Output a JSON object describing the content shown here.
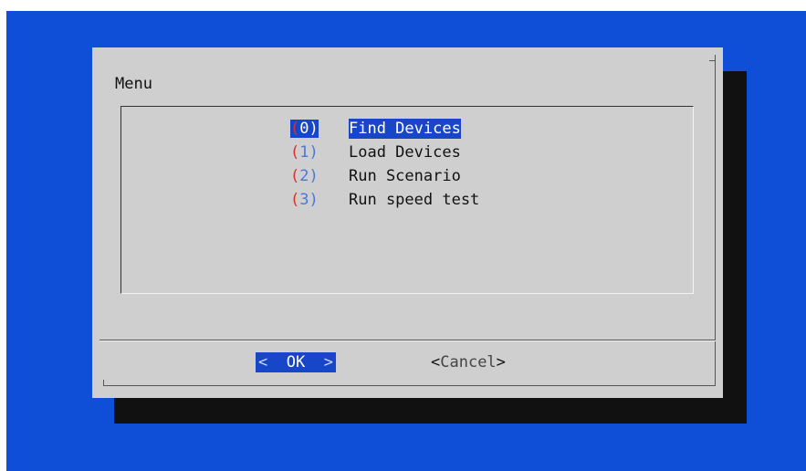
{
  "dialog": {
    "title": "Menu"
  },
  "menu": {
    "items": [
      {
        "tag": "0",
        "label": "Find Devices",
        "selected": true
      },
      {
        "tag": "1",
        "label": "Load Devices",
        "selected": false
      },
      {
        "tag": "2",
        "label": "Run Scenario",
        "selected": false
      },
      {
        "tag": "3",
        "label": "Run speed test",
        "selected": false
      }
    ]
  },
  "buttons": {
    "ok_label": "OK",
    "ok_left": "<",
    "ok_right": ">",
    "cancel_open": "<",
    "cancel_label": "Cancel",
    "cancel_close": ">"
  },
  "colors": {
    "background": "#0f4fd8",
    "dialog": "#cfcfcf",
    "selection": "#1846c8",
    "tag_paren": "#d9302c",
    "tag_number": "#4a78d8",
    "shadow": "#111111"
  }
}
